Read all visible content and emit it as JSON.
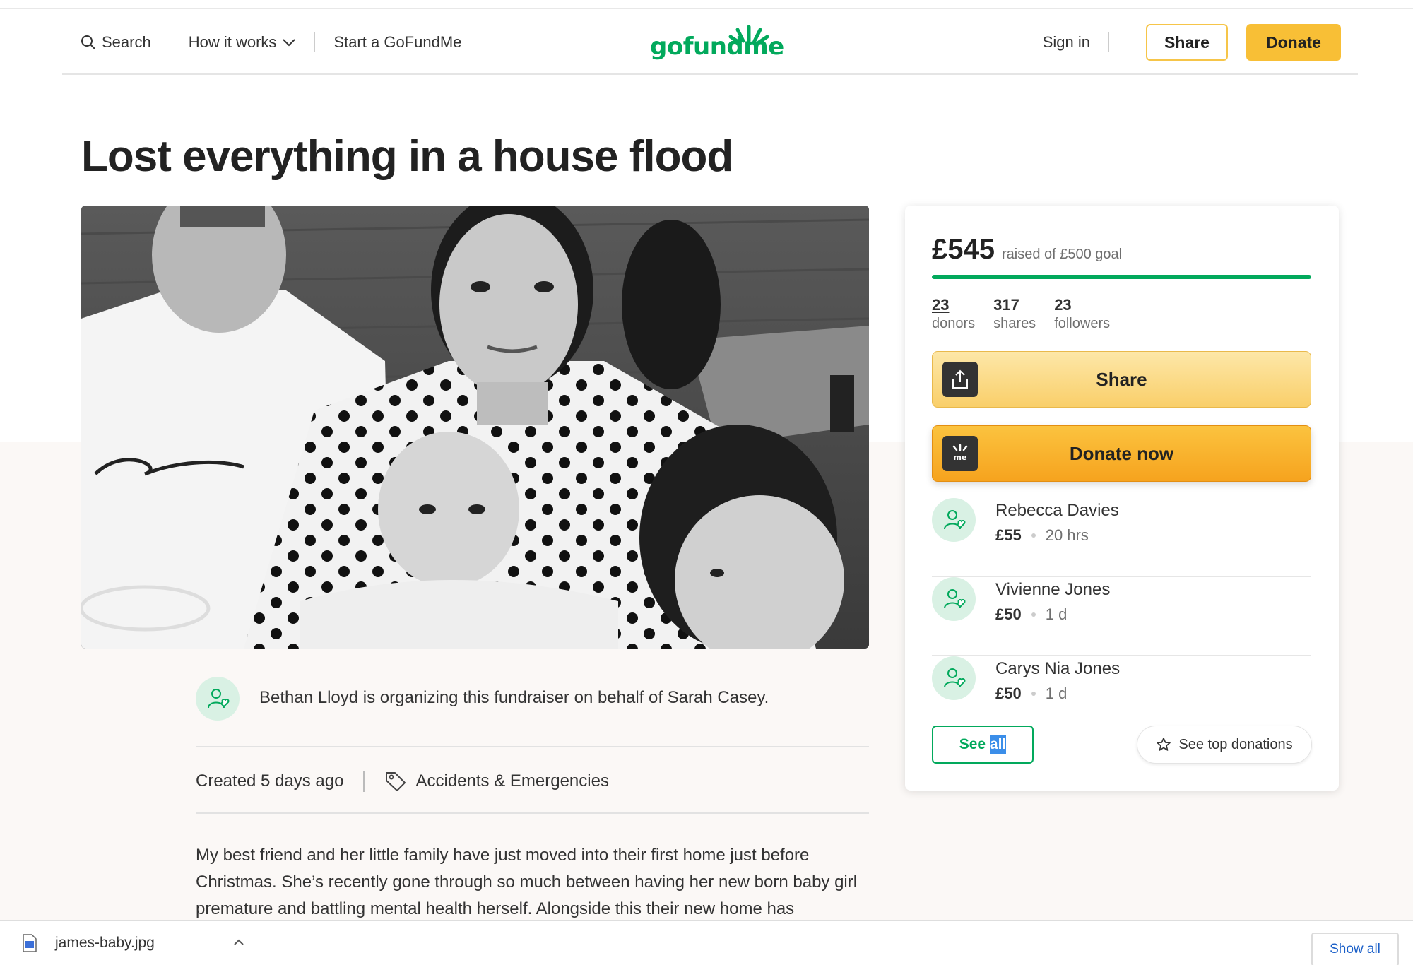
{
  "header": {
    "search_label": "Search",
    "how_it_works_label": "How it works",
    "start_label": "Start a GoFundMe",
    "logo_text": "gofundme",
    "signin_label": "Sign in",
    "share_label": "Share",
    "donate_label": "Donate"
  },
  "campaign": {
    "title": "Lost everything in a house flood",
    "organizer_text": "Bethan Lloyd is organizing this fundraiser on behalf of Sarah Casey.",
    "created": "Created 5 days ago",
    "category": "Accidents & Emergencies",
    "story": "My best friend and her little family have just moved into their first home just before Christmas. She’s recently gone through so much between having her new born baby girl premature and battling mental health herself. Alongside this their new home has"
  },
  "sidebar": {
    "amount": "£545",
    "goal_text": "raised of £500 goal",
    "progress": 1.0,
    "stats": [
      {
        "num": "23",
        "label": "donors"
      },
      {
        "num": "317",
        "label": "shares"
      },
      {
        "num": "23",
        "label": "followers"
      }
    ],
    "share_button": "Share",
    "donate_button": "Donate now",
    "donations": [
      {
        "name": "Rebecca Davies",
        "amount": "£55",
        "time": "20 hrs"
      },
      {
        "name": "Vivienne Jones",
        "amount": "£50",
        "time": "1 d"
      },
      {
        "name": "Carys Nia Jones",
        "amount": "£50",
        "time": "1 d"
      }
    ],
    "see_all_prefix": "See ",
    "see_all_selected": "all",
    "top_donations_label": "See top donations"
  },
  "downloads": {
    "file_name": "james-baby.jpg",
    "show_all_label": "Show all"
  },
  "colors": {
    "brand_green": "#02a95c",
    "donate_yellow": "#f8bf36",
    "link_blue": "#1a5fc8"
  }
}
